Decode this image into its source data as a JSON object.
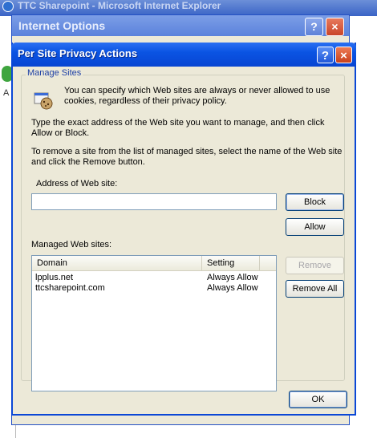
{
  "background_window": {
    "title": "TTC Sharepoint - Microsoft Internet Explorer",
    "side_letter": "A"
  },
  "internet_options": {
    "title": "Internet Options",
    "help_glyph": "?",
    "close_glyph": "×"
  },
  "dialog": {
    "title": "Per Site Privacy Actions",
    "help_glyph": "?",
    "close_glyph": "×",
    "group_label": "Manage Sites",
    "info_text": "You can specify which Web sites are always or never allowed to use cookies, regardless of their privacy policy.",
    "instruction_1": "Type the exact address of the Web site you want to manage, and then click Allow or Block.",
    "instruction_2": "To remove a site from the list of managed sites, select the name of the Web site and click the Remove button.",
    "address_label": "Address of Web site:",
    "address_value": "",
    "managed_label": "Managed Web sites:",
    "columns": [
      "Domain",
      "Setting"
    ],
    "rows": [
      {
        "domain": "lpplus.net",
        "setting": "Always Allow"
      },
      {
        "domain": "ttcsharepoint.com",
        "setting": "Always Allow"
      }
    ],
    "buttons": {
      "block": "Block",
      "allow": "Allow",
      "remove": "Remove",
      "remove_all": "Remove All",
      "ok": "OK"
    }
  },
  "colors": {
    "titlebar_blue": "#0a54e3",
    "dialog_face": "#ece9d8",
    "group_label": "#1c3fa5"
  }
}
